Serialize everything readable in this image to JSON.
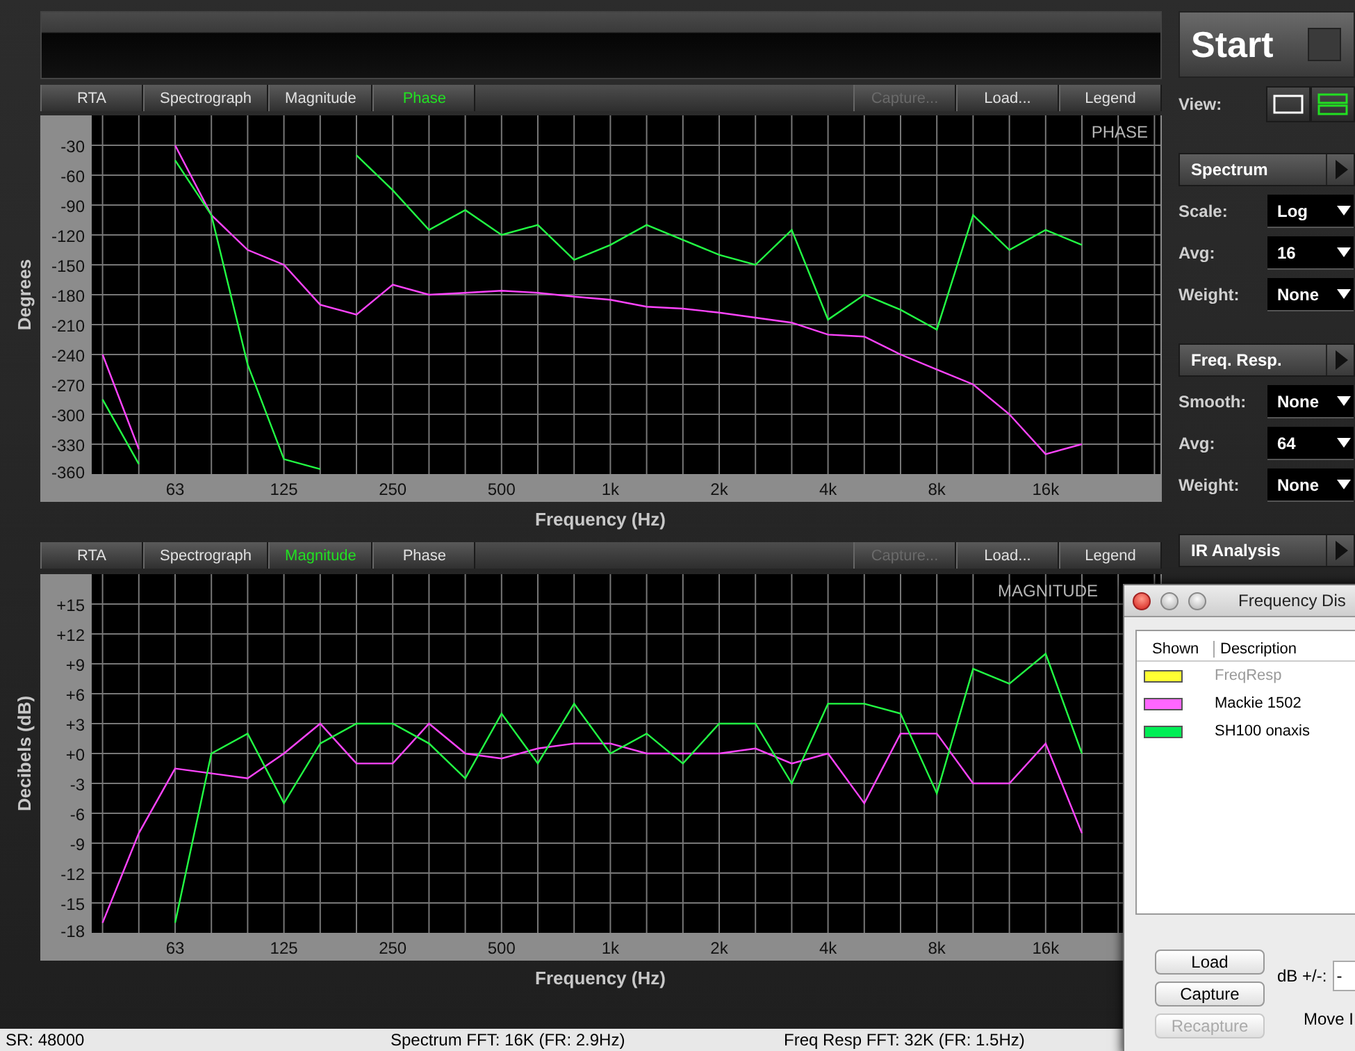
{
  "upper_panel": {
    "tabs": [
      {
        "label": "RTA",
        "kind": "tab",
        "selected": false
      },
      {
        "label": "Spectrograph",
        "kind": "tab",
        "selected": false
      },
      {
        "label": "Magnitude",
        "kind": "tab",
        "selected": false
      },
      {
        "label": "Phase",
        "kind": "tab",
        "selected": true
      },
      {
        "label": "Capture...",
        "kind": "action",
        "disabled": true
      },
      {
        "label": "Load...",
        "kind": "action",
        "disabled": false
      },
      {
        "label": "Legend",
        "kind": "action",
        "disabled": false
      }
    ],
    "chart_data": {
      "type": "line",
      "title": "PHASE",
      "xlabel": "Frequency (Hz)",
      "ylabel": "Degrees",
      "categories": [
        null,
        null,
        "63",
        null,
        null,
        "125",
        null,
        null,
        "250",
        null,
        null,
        "500",
        null,
        null,
        "1k",
        null,
        null,
        "2k",
        null,
        null,
        "4k",
        null,
        null,
        "8k",
        null,
        null,
        "16k",
        null,
        null
      ],
      "series": [
        {
          "color": "#ff44ff",
          "values": [
            -240,
            -335,
            -30,
            -100,
            -135,
            -150,
            -190,
            -200,
            -170,
            -180,
            -178,
            -176,
            -178,
            -182,
            -185,
            -192,
            -194,
            -198,
            -203,
            -208,
            -220,
            -222,
            -240,
            -255,
            -270,
            -300,
            -340,
            -330,
            null
          ]
        },
        {
          "color": "#22ff44",
          "values": [
            -285,
            -350,
            -45,
            -100,
            -250,
            -345,
            -355,
            -40,
            -75,
            -115,
            -95,
            -120,
            -110,
            -145,
            -130,
            -110,
            -125,
            -140,
            -150,
            -115,
            -205,
            -180,
            -195,
            -215,
            -100,
            -135,
            -115,
            -130,
            null
          ]
        }
      ],
      "ylim": [
        -360,
        0
      ],
      "grid": true,
      "yticks": [
        -30,
        -60,
        -90,
        -120,
        -150,
        -180,
        -210,
        -240,
        -270,
        -300,
        -330,
        -360
      ]
    }
  },
  "lower_panel": {
    "tabs": [
      {
        "label": "RTA",
        "kind": "tab",
        "selected": false
      },
      {
        "label": "Spectrograph",
        "kind": "tab",
        "selected": false
      },
      {
        "label": "Magnitude",
        "kind": "tab",
        "selected": true
      },
      {
        "label": "Phase",
        "kind": "tab",
        "selected": false
      },
      {
        "label": "Capture...",
        "kind": "action",
        "disabled": true
      },
      {
        "label": "Load...",
        "kind": "action",
        "disabled": false
      },
      {
        "label": "Legend",
        "kind": "action",
        "disabled": false
      }
    ],
    "chart_data": {
      "type": "line",
      "title": "MAGNITUDE",
      "xlabel": "Frequency (Hz)",
      "ylabel": "Decibels (dB)",
      "categories": [
        null,
        null,
        "63",
        null,
        null,
        "125",
        null,
        null,
        "250",
        null,
        null,
        "500",
        null,
        null,
        "1k",
        null,
        null,
        "2k",
        null,
        null,
        "4k",
        null,
        null,
        "8k",
        null,
        null,
        "16k",
        null,
        null
      ],
      "series": [
        {
          "color": "#ff44ff",
          "values": [
            -17,
            -8,
            -1.5,
            -2,
            -2.5,
            0,
            3,
            -1,
            -1,
            3,
            0,
            -0.5,
            0.5,
            1,
            1,
            0,
            0,
            0,
            0.5,
            -1,
            0,
            -5,
            2,
            2,
            -3,
            -3,
            1,
            -8,
            null
          ]
        },
        {
          "color": "#22ff44",
          "values": [
            null,
            null,
            -17,
            0,
            2,
            -5,
            1,
            3,
            3,
            1,
            -2.5,
            4,
            -1,
            5,
            0,
            2,
            -1,
            3,
            3,
            -3,
            5,
            5,
            4,
            -4,
            8.5,
            7,
            10,
            0,
            null
          ]
        }
      ],
      "ylim": [
        -18,
        18
      ],
      "grid": true,
      "yticks": [
        {
          "value": 15,
          "label": "+15"
        },
        {
          "value": 12,
          "label": "+12"
        },
        {
          "value": 9,
          "label": "+9"
        },
        {
          "value": 6,
          "label": "+6"
        },
        {
          "value": 3,
          "label": "+3"
        },
        {
          "value": 0,
          "label": "+0"
        },
        {
          "value": -3,
          "label": "-3"
        },
        {
          "value": -6,
          "label": "-6"
        },
        {
          "value": -9,
          "label": "-9"
        },
        {
          "value": -12,
          "label": "-12"
        },
        {
          "value": -15,
          "label": "-15"
        },
        {
          "value": -18,
          "label": "-18"
        }
      ]
    }
  },
  "side_panel": {
    "start_button": "Start",
    "view": {
      "label": "View:",
      "options": [
        {
          "kind": "single",
          "selected": false
        },
        {
          "kind": "split",
          "selected": true
        }
      ]
    },
    "sections": [
      {
        "title": "Spectrum",
        "settings": [
          {
            "label": "Scale:",
            "value": "Log"
          },
          {
            "label": "Avg:",
            "value": "16"
          },
          {
            "label": "Weight:",
            "value": "None"
          }
        ]
      },
      {
        "title": "Freq. Resp.",
        "settings": [
          {
            "label": "Smooth:",
            "value": "None"
          },
          {
            "label": "Avg:",
            "value": "64"
          },
          {
            "label": "Weight:",
            "value": "None"
          }
        ]
      },
      {
        "title": "IR Analysis"
      }
    ]
  },
  "legend_window": {
    "title": "Frequency Dis",
    "columns": [
      "Shown",
      "Description"
    ],
    "rows": [
      {
        "description": "FreqResp",
        "color": "#ffff33",
        "disabled": true
      },
      {
        "description": "Mackie 1502",
        "color": "#ff66ff",
        "disabled": false
      },
      {
        "description": "SH100 onaxis",
        "color": "#00ee55",
        "disabled": false
      }
    ],
    "buttons": [
      {
        "label": "Load",
        "disabled": false
      },
      {
        "label": "Capture",
        "disabled": false
      },
      {
        "label": "Recapture",
        "disabled": true
      }
    ],
    "db_field": {
      "label": "dB +/-:",
      "value": "-"
    },
    "move_label": "Move I"
  },
  "status_bar": [
    "SR: 48000",
    "Spectrum FFT: 16K (FR: 2.9Hz)",
    "Freq Resp FFT: 32K (FR: 1.5Hz)"
  ]
}
